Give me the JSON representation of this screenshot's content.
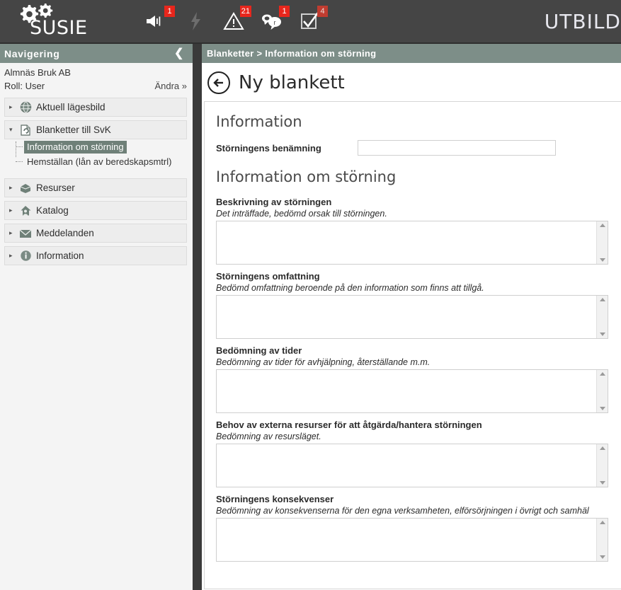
{
  "topbar": {
    "brand_name": "SUSIE",
    "brand_icon": "gears-icon",
    "env_label": "UTBILD",
    "icons": [
      {
        "name": "speaker-icon",
        "badge": "1",
        "muted": false
      },
      {
        "name": "lightning-bolt-icon",
        "badge": "",
        "muted": false
      },
      {
        "name": "warning-triangle-icon",
        "badge": "21",
        "muted": false
      },
      {
        "name": "speech-bubbles-icon",
        "badge": "1",
        "muted": false
      },
      {
        "name": "checkbox-check-icon",
        "badge": "4",
        "muted": true
      }
    ]
  },
  "sidebar": {
    "header_title": "Navigering",
    "collapse_icon": "❮",
    "org_name": "Almnäs Bruk AB",
    "role_label": "Roll: User",
    "change_link": "Ändra »",
    "groups": [
      {
        "label": "Aktuell lägesbild",
        "icon": "globe-icon",
        "twisty": "▸",
        "expanded": false
      },
      {
        "label": "Blanketter till SvK",
        "icon": "form-document-icon",
        "twisty": "▾",
        "expanded": true
      },
      {
        "label": "Resurser",
        "icon": "package-box-icon",
        "twisty": "▸",
        "expanded": false
      },
      {
        "label": "Katalog",
        "icon": "house-person-icon",
        "twisty": "▸",
        "expanded": false
      },
      {
        "label": "Meddelanden",
        "icon": "envelope-icon",
        "twisty": "▸",
        "expanded": false
      },
      {
        "label": "Information",
        "icon": "info-circle-icon",
        "twisty": "▸",
        "expanded": false
      }
    ],
    "subtree": [
      {
        "label": "Information om störning",
        "selected": true
      },
      {
        "label": "Hemställan (lån av beredskapsmtrl)",
        "selected": false
      }
    ]
  },
  "main": {
    "breadcrumb": "Blanketter > Information om störning",
    "back_icon": "back-arrow-icon",
    "page_title": "Ny blankett",
    "section_one_title": "Information",
    "section_two_title": "Information om störning",
    "name_field": {
      "label": "Störningens benämning",
      "value": "",
      "placeholder": ""
    },
    "fields": [
      {
        "label": "Beskrivning av störningen",
        "hint": "Det inträffade, bedömd orsak till störningen.",
        "value": ""
      },
      {
        "label": "Störningens omfattning",
        "hint": "Bedömd omfattning beroende på den information som finns att tillgå.",
        "value": ""
      },
      {
        "label": "Bedömning av tider",
        "hint": "Bedömning av tider för avhjälpning, återställande m.m.",
        "value": ""
      },
      {
        "label": "Behov av externa resurser för att åtgärda/hantera störningen",
        "hint": "Bedömning av resursläget.",
        "value": ""
      },
      {
        "label": "Störningens konsekvenser",
        "hint": "Bedömning av konsekvenserna för den egna verksamheten, elförsörjningen i övrigt och samhäl",
        "value": ""
      }
    ]
  },
  "colors": {
    "topbar_bg": "#454545",
    "accent_sage": "#7d8e88",
    "selected_item": "#6f8078",
    "badge_red": "#e8261c",
    "divider_dark": "#3a3a3a",
    "sidebar_bg": "#f4f4f4"
  }
}
